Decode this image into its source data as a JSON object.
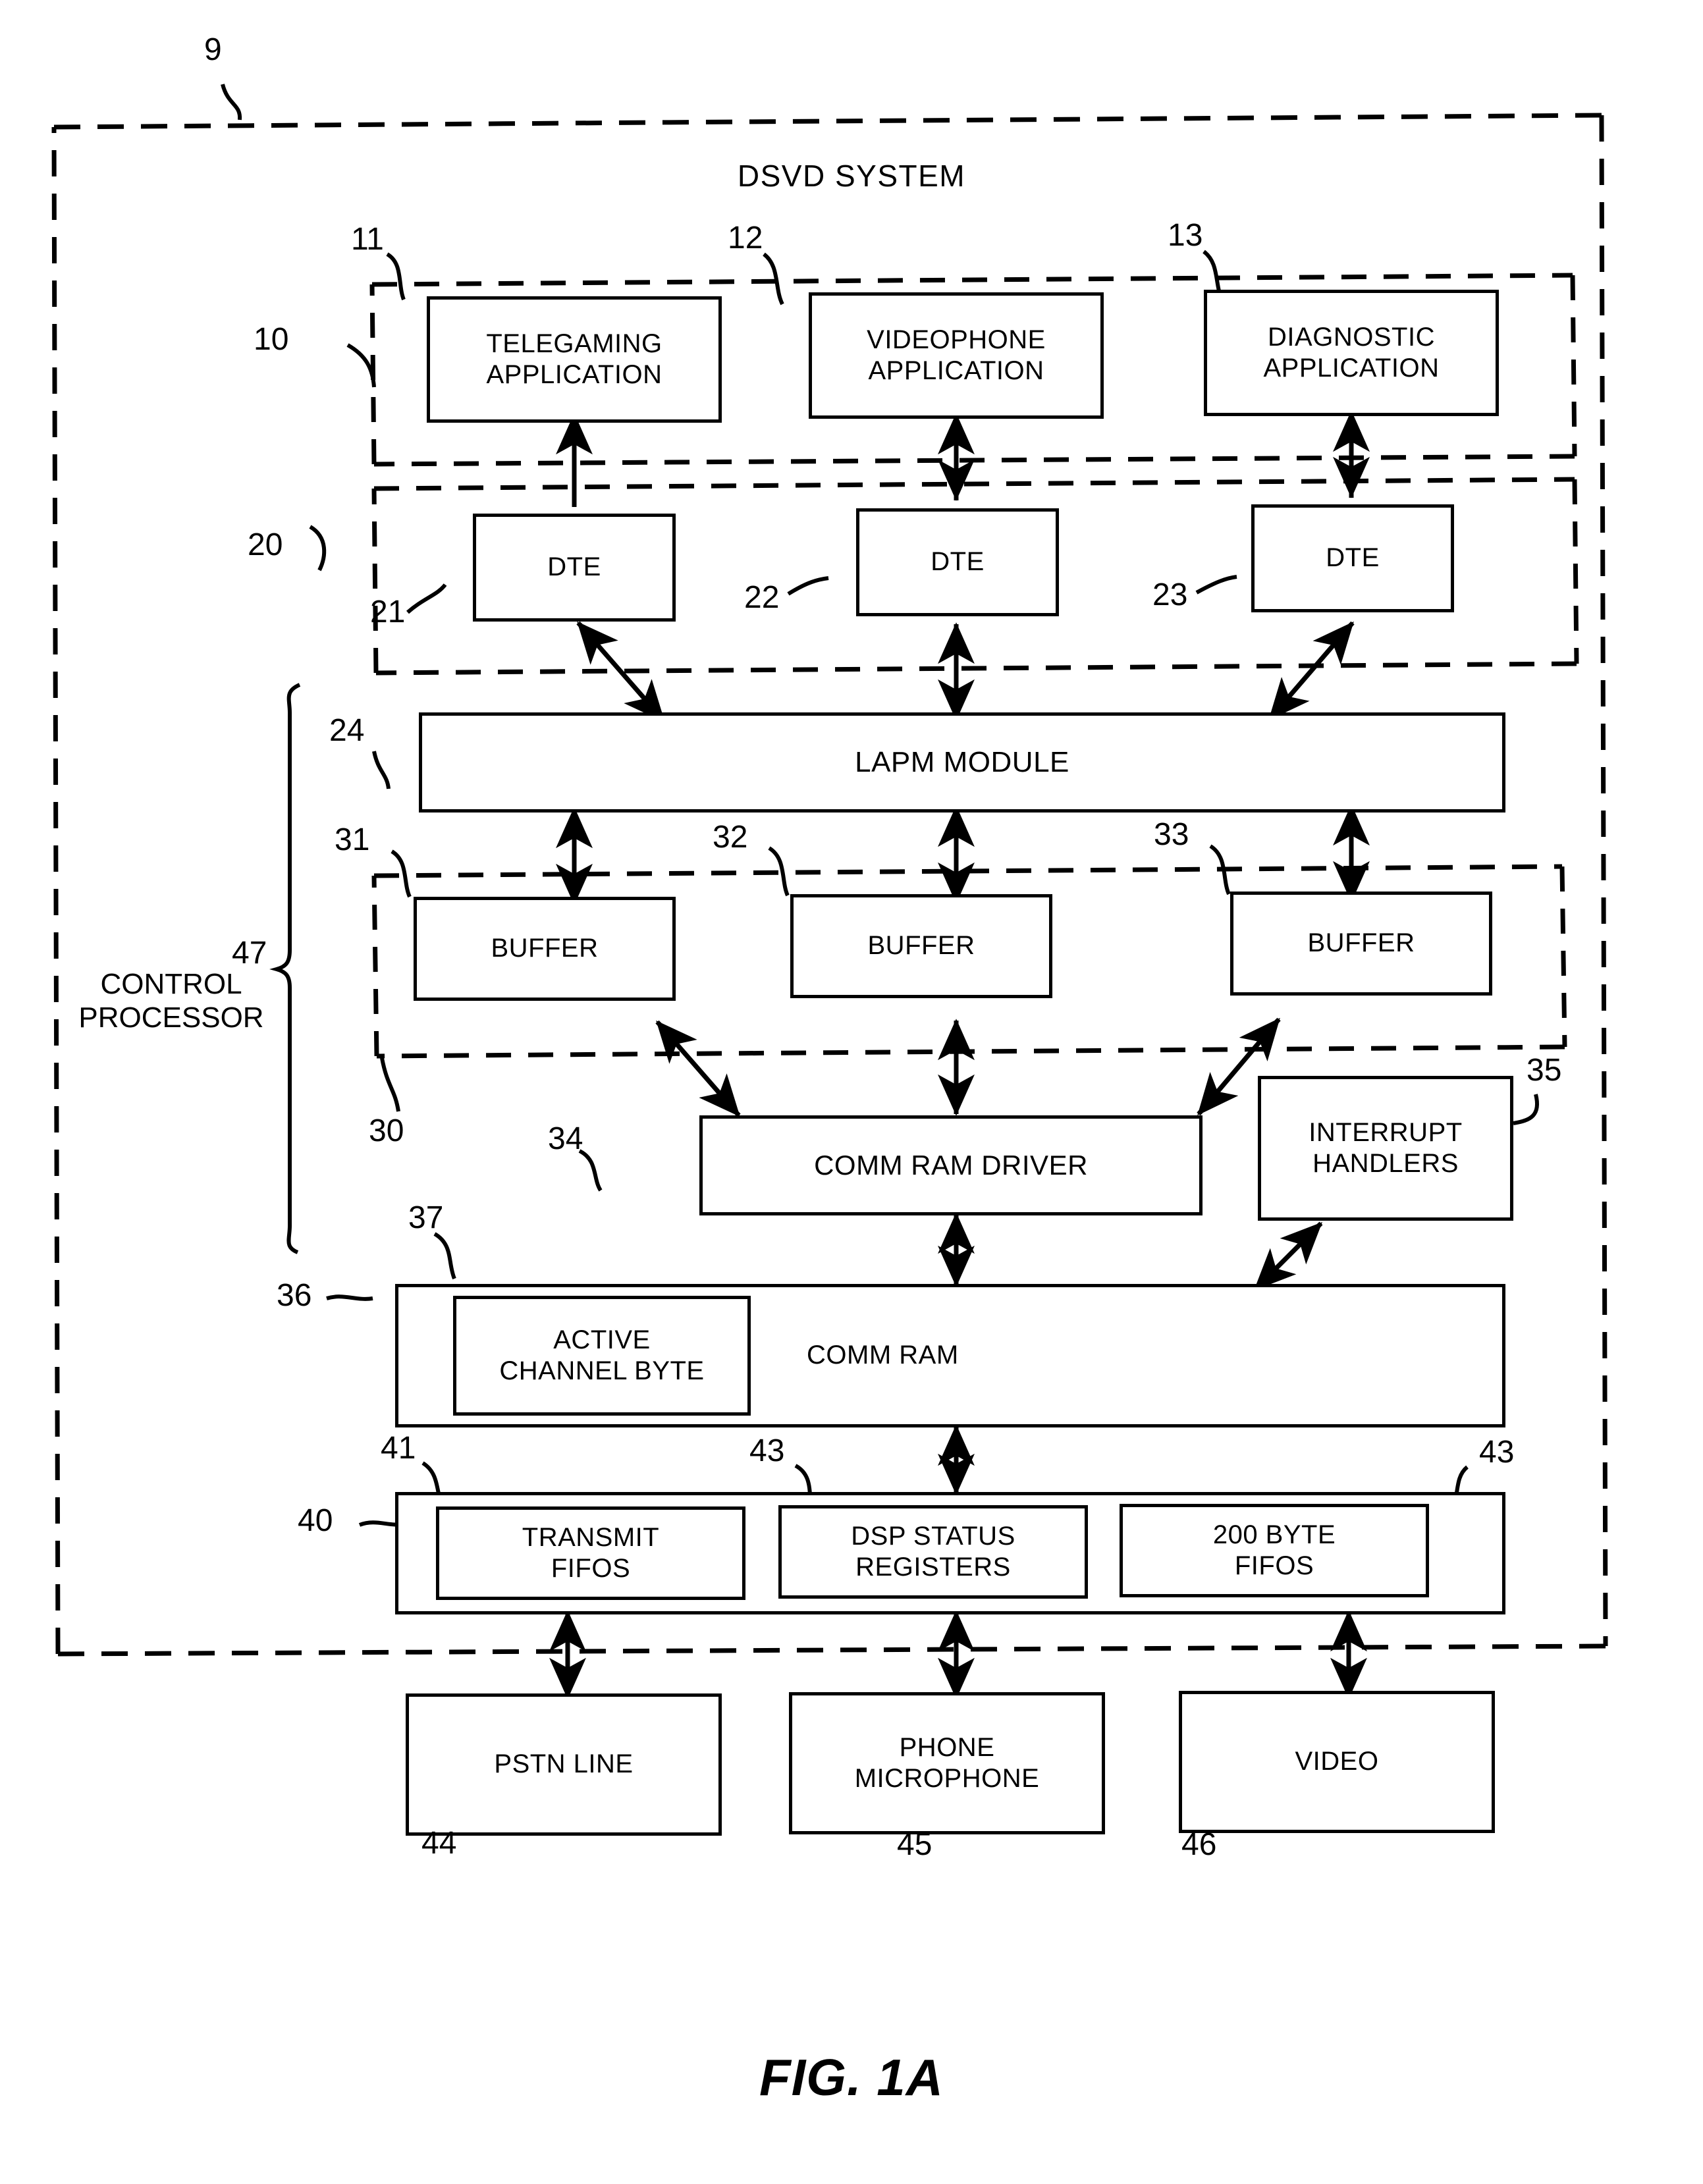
{
  "figure": {
    "label": "FIG. 1A",
    "system_title": "DSVD SYSTEM",
    "system_ref": "9"
  },
  "groups": {
    "applications_ref": "10",
    "dte_group_ref": "20",
    "buffer_group_ref": "30",
    "control_processor_ref": "47",
    "control_processor_label": "CONTROL\nPROCESSOR"
  },
  "blocks": {
    "telegaming": {
      "label": "TELEGAMING\nAPPLICATION",
      "ref": "11"
    },
    "videophone": {
      "label": "VIDEOPHONE\nAPPLICATION",
      "ref": "12"
    },
    "diagnostic": {
      "label": "DIAGNOSTIC\nAPPLICATION",
      "ref": "13"
    },
    "dte1": {
      "label": "DTE",
      "ref": "21"
    },
    "dte2": {
      "label": "DTE",
      "ref": "22"
    },
    "dte3": {
      "label": "DTE",
      "ref": "23"
    },
    "lapm": {
      "label": "LAPM MODULE",
      "ref": "24"
    },
    "buffer1": {
      "label": "BUFFER",
      "ref": "31"
    },
    "buffer2": {
      "label": "BUFFER",
      "ref": "32"
    },
    "buffer3": {
      "label": "BUFFER",
      "ref": "33"
    },
    "comm_ram_driver": {
      "label": "COMM RAM DRIVER",
      "ref": "34"
    },
    "interrupt_handlers": {
      "label": "INTERRUPT\nHANDLERS",
      "ref": "35"
    },
    "comm_ram": {
      "label": "COMM RAM",
      "ref": "36"
    },
    "active_channel_byte": {
      "label": "ACTIVE\nCHANNEL BYTE",
      "ref": "37"
    },
    "dsp_container": {
      "ref": "40"
    },
    "transmit_fifos": {
      "label": "TRANSMIT\nFIFOS",
      "ref": "41"
    },
    "dsp_status_registers": {
      "label": "DSP STATUS\nREGISTERS",
      "ref": "43"
    },
    "byte_fifos": {
      "label": "200 BYTE\nFIFOS",
      "ref": "43"
    },
    "pstn_line": {
      "label": "PSTN LINE",
      "ref": "44"
    },
    "phone_microphone": {
      "label": "PHONE\nMICROPHONE",
      "ref": "45"
    },
    "video": {
      "label": "VIDEO",
      "ref": "46"
    }
  }
}
